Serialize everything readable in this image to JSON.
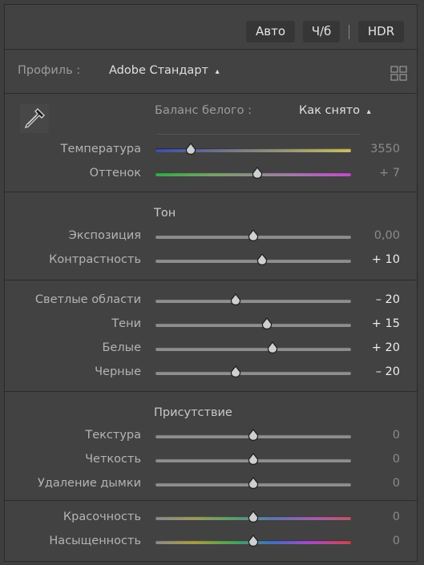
{
  "toolbar": {
    "auto_label": "Авто",
    "bw_label": "Ч/б",
    "hdr_label": "HDR"
  },
  "profile": {
    "label": "Профиль :",
    "value": "Adobe Стандарт",
    "arrow": "⬍"
  },
  "white_balance": {
    "label": "Баланс белого :",
    "value": "Как снято",
    "arrow": "⬍"
  },
  "sliders": {
    "temperature": {
      "label": "Температура",
      "value": "3550",
      "position": 0.18
    },
    "tint": {
      "label": "Оттенок",
      "value": "+ 7",
      "position": 0.52
    },
    "exposure": {
      "label": "Экспозиция",
      "value": "0,00",
      "position": 0.5
    },
    "contrast": {
      "label": "Контрастность",
      "value": "+ 10",
      "position": 0.545
    },
    "highlights": {
      "label": "Светлые области",
      "value": "– 20",
      "position": 0.41
    },
    "shadows": {
      "label": "Тени",
      "value": "+ 15",
      "position": 0.57
    },
    "whites": {
      "label": "Белые",
      "value": "+ 20",
      "position": 0.6
    },
    "blacks": {
      "label": "Черные",
      "value": "– 20",
      "position": 0.41
    },
    "texture": {
      "label": "Текстура",
      "value": "0",
      "position": 0.5
    },
    "clarity": {
      "label": "Четкость",
      "value": "0",
      "position": 0.5
    },
    "dehaze": {
      "label": "Удаление дымки",
      "value": "0",
      "position": 0.5
    },
    "vibrance": {
      "label": "Красочность",
      "value": "0",
      "position": 0.5
    },
    "saturation": {
      "label": "Насыщенность",
      "value": "0",
      "position": 0.5
    }
  },
  "sections": {
    "tone": "Тон",
    "presence": "Присутствие"
  },
  "icons": {
    "eyedropper": "eyedropper-icon",
    "profile_browser": "grid-icon"
  }
}
